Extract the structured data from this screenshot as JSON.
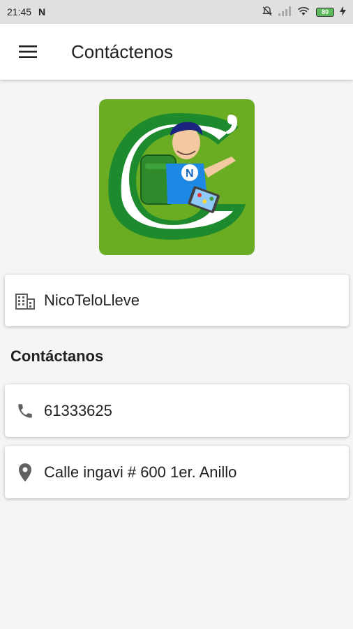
{
  "status_bar": {
    "time": "21:45",
    "app_indicator": "N",
    "battery": "80"
  },
  "app_bar": {
    "menu_icon": "menu-icon",
    "title": "Contáctenos"
  },
  "company": {
    "icon": "building-icon",
    "name": "NicoTeloLleve"
  },
  "contact_section": {
    "title": "Contáctanos",
    "phone": {
      "icon": "phone-icon",
      "value": "61333625"
    },
    "address": {
      "icon": "location-pin-icon",
      "value": "Calle ingavi # 600 1er. Anillo"
    }
  },
  "colors": {
    "logo_green": "#6aad22",
    "logo_dark_green": "#1e8a2e",
    "icon_grey": "#616161"
  }
}
